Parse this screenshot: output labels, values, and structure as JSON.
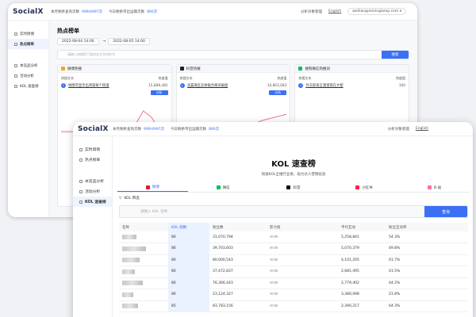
{
  "back_window": {
    "logo": "SocialX",
    "top": {
      "quota1_label": "本月剩余查询次数",
      "quota1_value": "999/4997次",
      "quota2_label": "今日剩余带出运输次数",
      "quota2_value": "890次",
      "account_mgmt": "分析对象管理",
      "language": "English",
      "user": "weilian@mininglamp.com"
    },
    "sidebar": [
      {
        "label": "实时舆情"
      },
      {
        "label": "热点榜单"
      },
      {
        "label": "本竞品分析"
      },
      {
        "label": "活动分析"
      },
      {
        "label": "KOL 速查榜"
      }
    ],
    "page_title": "热点榜单",
    "date_start": "2022-08-04 14:00",
    "date_sep": "→",
    "date_end": "2022-08-05 14:00",
    "search_placeholder": "请输入热搜榜下面的关注字词符号",
    "search_button": "搜索",
    "cards": [
      {
        "title": "微博热搜",
        "col1": "热搜文本",
        "col2": "热度值",
        "row_title": "地图可显示出湾案每个街道",
        "row_value": "15,888,481",
        "button": "分析"
      },
      {
        "title": "抖音热搜",
        "col1": "热搜文本",
        "col2": "热度值",
        "row_title": "北晨清区实体联合视讯磁盘",
        "row_value": "10,803,083",
        "button": "分析"
      },
      {
        "title": "搜狗微信热搜词",
        "col1": "热搜文本",
        "col2": "热度值",
        "row_title": "外交部发言澳溜现在大使",
        "row_value": "100",
        "button": ""
      }
    ]
  },
  "front_window": {
    "logo": "SocialX",
    "top": {
      "quota1_label": "本月剩余查询次数",
      "quota1_value": "999/4997次",
      "quota2_label": "今日剩余带出运输次数",
      "quota2_value": "890次",
      "account_mgmt": "分析对象管理",
      "language": "English"
    },
    "sidebar": [
      {
        "label": "实时舆情"
      },
      {
        "label": "热点榜单"
      },
      {
        "label": "本竞品分析"
      },
      {
        "label": "活动分析"
      },
      {
        "label": "KOL 速查榜"
      }
    ],
    "page_title": "KOL 速查榜",
    "subtitle": "快速KOL全维行业榜，助力达人营销投放",
    "platforms": [
      {
        "label": "微博",
        "color": "#e6162d"
      },
      {
        "label": "微信",
        "color": "#07c160"
      },
      {
        "label": "抖音",
        "color": "#111111"
      },
      {
        "label": "小红书",
        "color": "#ff2442"
      },
      {
        "label": "B 站",
        "color": "#fb7299"
      }
    ],
    "filter_label": "KOL 筛选",
    "search_placeholder": "请输入 KOL 名称",
    "search_button": "查询",
    "table": {
      "columns": [
        "名称",
        "KOL 指数",
        "粉丝数",
        "影力值",
        "",
        "平均互动",
        "粉丝互动率"
      ],
      "rows": [
        {
          "index": "86",
          "fans": "31,070,794",
          "avg": "5,258,841",
          "rate": "54.3%"
        },
        {
          "index": "86",
          "fans": "39,703,603",
          "avg": "5,070,379",
          "rate": "49.8%"
        },
        {
          "index": "86",
          "fans": "80,000,543",
          "avg": "4,101,205",
          "rate": "41.7%"
        },
        {
          "index": "86",
          "fans": "37,472,837",
          "avg": "2,681,495",
          "rate": "41.5%"
        },
        {
          "index": "86",
          "fans": "76,366,443",
          "avg": "2,779,402",
          "rate": "44.2%"
        },
        {
          "index": "86",
          "fans": "23,124,327",
          "avg": "3,380,098",
          "rate": "21.8%"
        },
        {
          "index": "85",
          "fans": "83,783,156",
          "avg": "2,390,217",
          "rate": "64.3%"
        }
      ]
    }
  }
}
